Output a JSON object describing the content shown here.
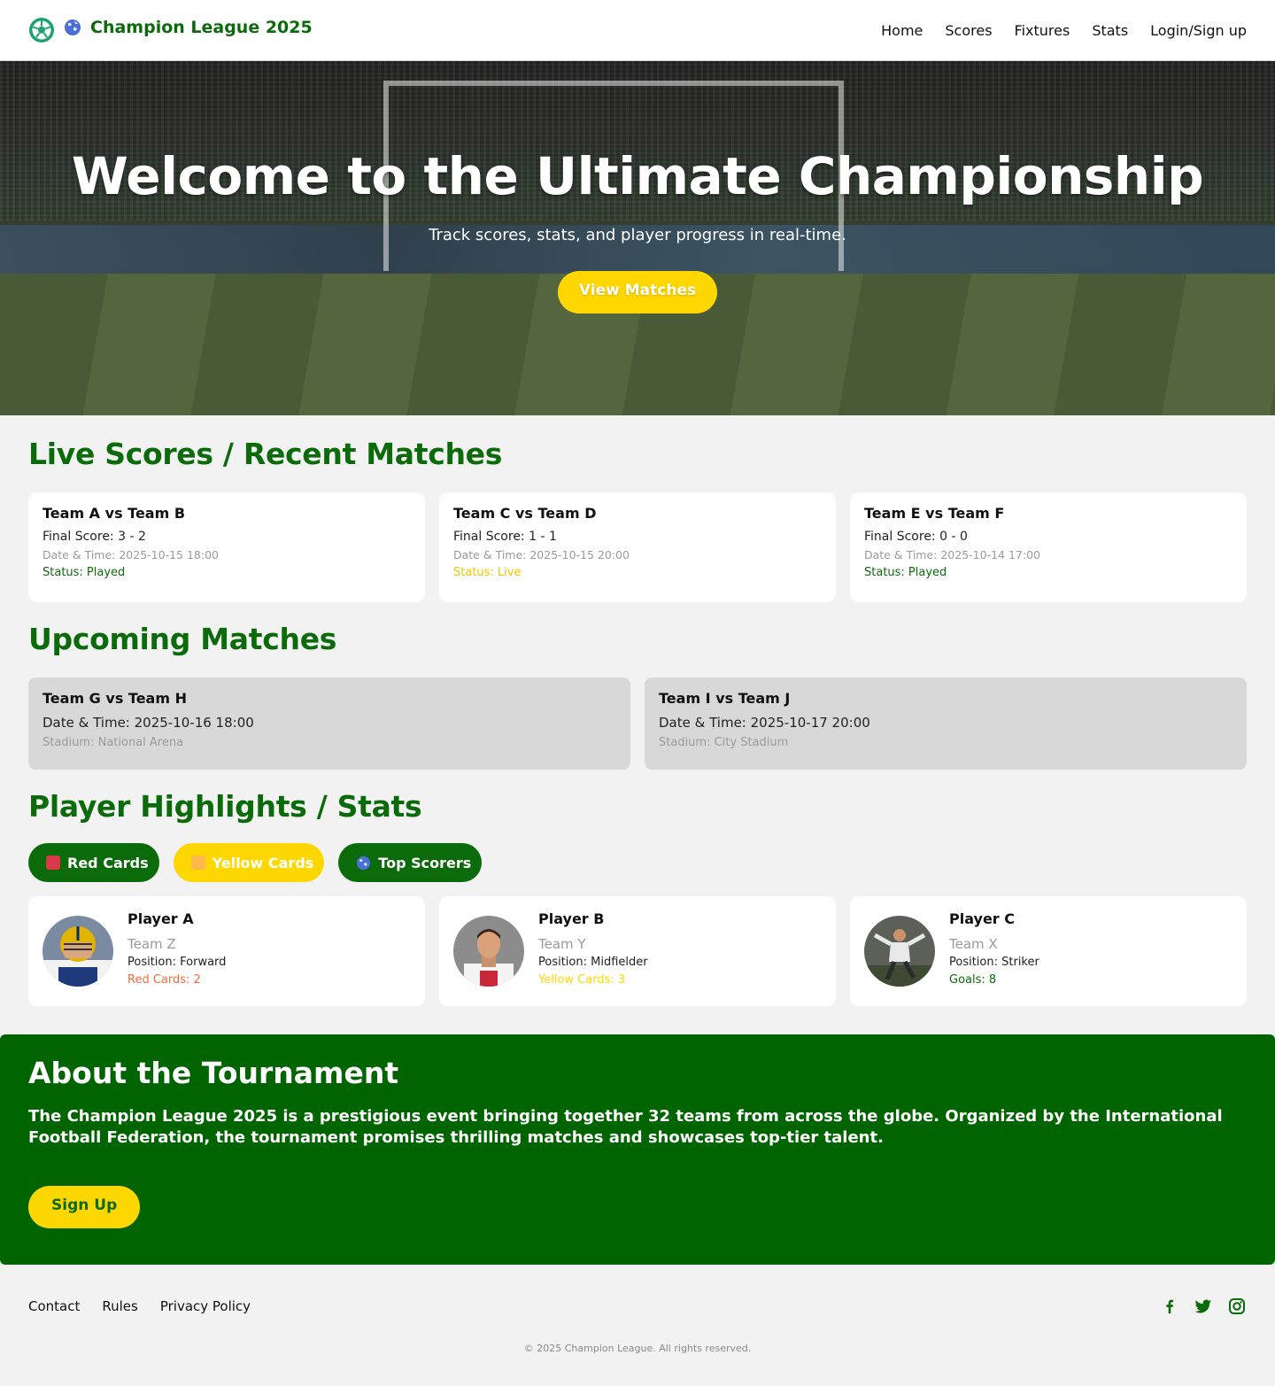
{
  "nav": {
    "brand_title": "Champion League 2025",
    "links": [
      "Home",
      "Scores",
      "Fixtures",
      "Stats",
      "Login/Sign up"
    ]
  },
  "hero": {
    "title": "Welcome to the Ultimate Championship",
    "subtitle": "Track scores, stats, and player progress in real-time.",
    "cta_label": "View Matches"
  },
  "live": {
    "title": "Live Scores / Recent Matches",
    "matches": [
      {
        "teams": "Team A vs Team B",
        "score": "Final Score: 3 - 2",
        "datetime": "Date & Time: 2025-10-15 18:00",
        "status": "Status: Played"
      },
      {
        "teams": "Team C vs Team D",
        "score": "Final Score: 1 - 1",
        "datetime": "Date & Time: 2025-10-15 20:00",
        "status": "Status: Live"
      },
      {
        "teams": "Team E vs Team F",
        "score": "Final Score: 0 - 0",
        "datetime": "Date & Time: 2025-10-14 17:00",
        "status": "Status: Played"
      }
    ]
  },
  "upcoming": {
    "title": "Upcoming Matches",
    "matches": [
      {
        "teams": "Team G vs Team H",
        "datetime": "Date & Time: 2025-10-16 18:00",
        "stadium": "Stadium: National Arena"
      },
      {
        "teams": "Team I vs Team J",
        "datetime": "Date & Time: 2025-10-17 20:00",
        "stadium": "Stadium: City Stadium"
      }
    ]
  },
  "players": {
    "title": "Player Highlights / Stats",
    "filters": [
      "Red Cards",
      "Yellow Cards",
      "Top Scorers"
    ],
    "cards": [
      {
        "name": "Player A",
        "team": "Team Z",
        "position": "Position: Forward",
        "stat": "Red Cards: 2"
      },
      {
        "name": "Player B",
        "team": "Team Y",
        "position": "Position: Midfielder",
        "stat": "Yellow Cards: 3"
      },
      {
        "name": "Player C",
        "team": "Team X",
        "position": "Position: Striker",
        "stat": "Goals: 8"
      }
    ]
  },
  "about": {
    "title": "About the Tournament",
    "text": "The Champion League 2025 is a prestigious event bringing together 32 teams from across the globe. Organized by the International Football Federation, the tournament promises thrilling matches and showcases top-tier talent.",
    "cta_label": "Sign Up"
  },
  "footer": {
    "links": [
      "Contact",
      "Rules",
      "Privacy Policy"
    ],
    "socials": [
      "facebook-icon",
      "twitter-icon",
      "instagram-icon"
    ],
    "copyright": "© 2025 Champion League. All rights reserved."
  },
  "colors": {
    "brand_green": "#0b6b0b",
    "about_green": "#006400",
    "accent_yellow": "#ffd700",
    "status_live": "#f2c500",
    "stat_red": "#f36a3a"
  }
}
